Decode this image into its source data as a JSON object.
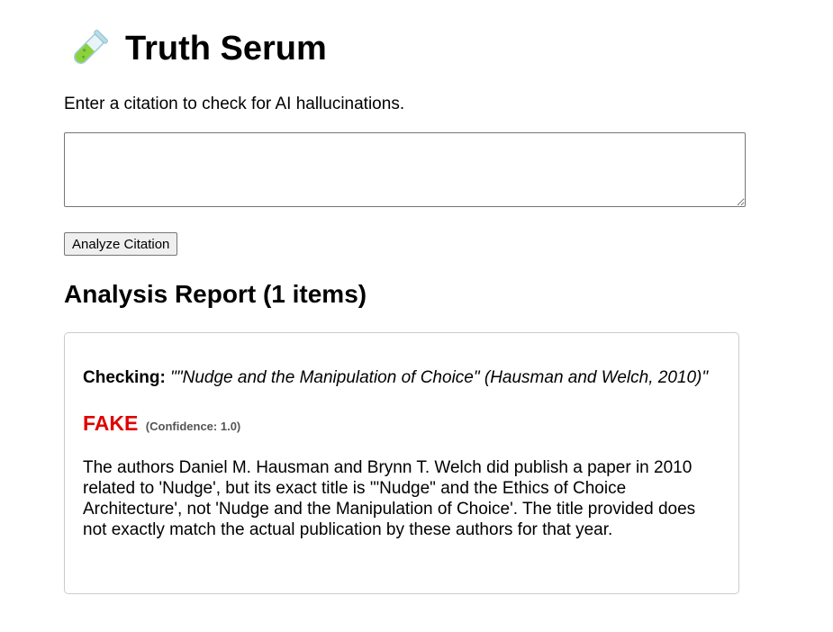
{
  "header": {
    "icon": "test-tube-icon",
    "title": "Truth Serum",
    "subtitle": "Enter a citation to check for AI hallucinations."
  },
  "input": {
    "value": "",
    "placeholder": ""
  },
  "actions": {
    "analyze_label": "Analyze Citation"
  },
  "report": {
    "heading": "Analysis Report (1 items)",
    "items": [
      {
        "checking_label": "Checking:",
        "citation": "\"\"Nudge and the Manipulation of Choice\" (Hausman and Welch, 2010)\"",
        "verdict": "FAKE",
        "confidence": "(Confidence: 1.0)",
        "explanation": "The authors Daniel M. Hausman and Brynn T. Welch did publish a paper in 2010 related to 'Nudge', but its exact title is '\"Nudge\" and the Ethics of Choice Architecture', not 'Nudge and the Manipulation of Choice'. The title provided does not exactly match the actual publication by these authors for that year."
      }
    ]
  },
  "colors": {
    "verdict_fake": "#e00000",
    "card_border": "#cccccc"
  }
}
